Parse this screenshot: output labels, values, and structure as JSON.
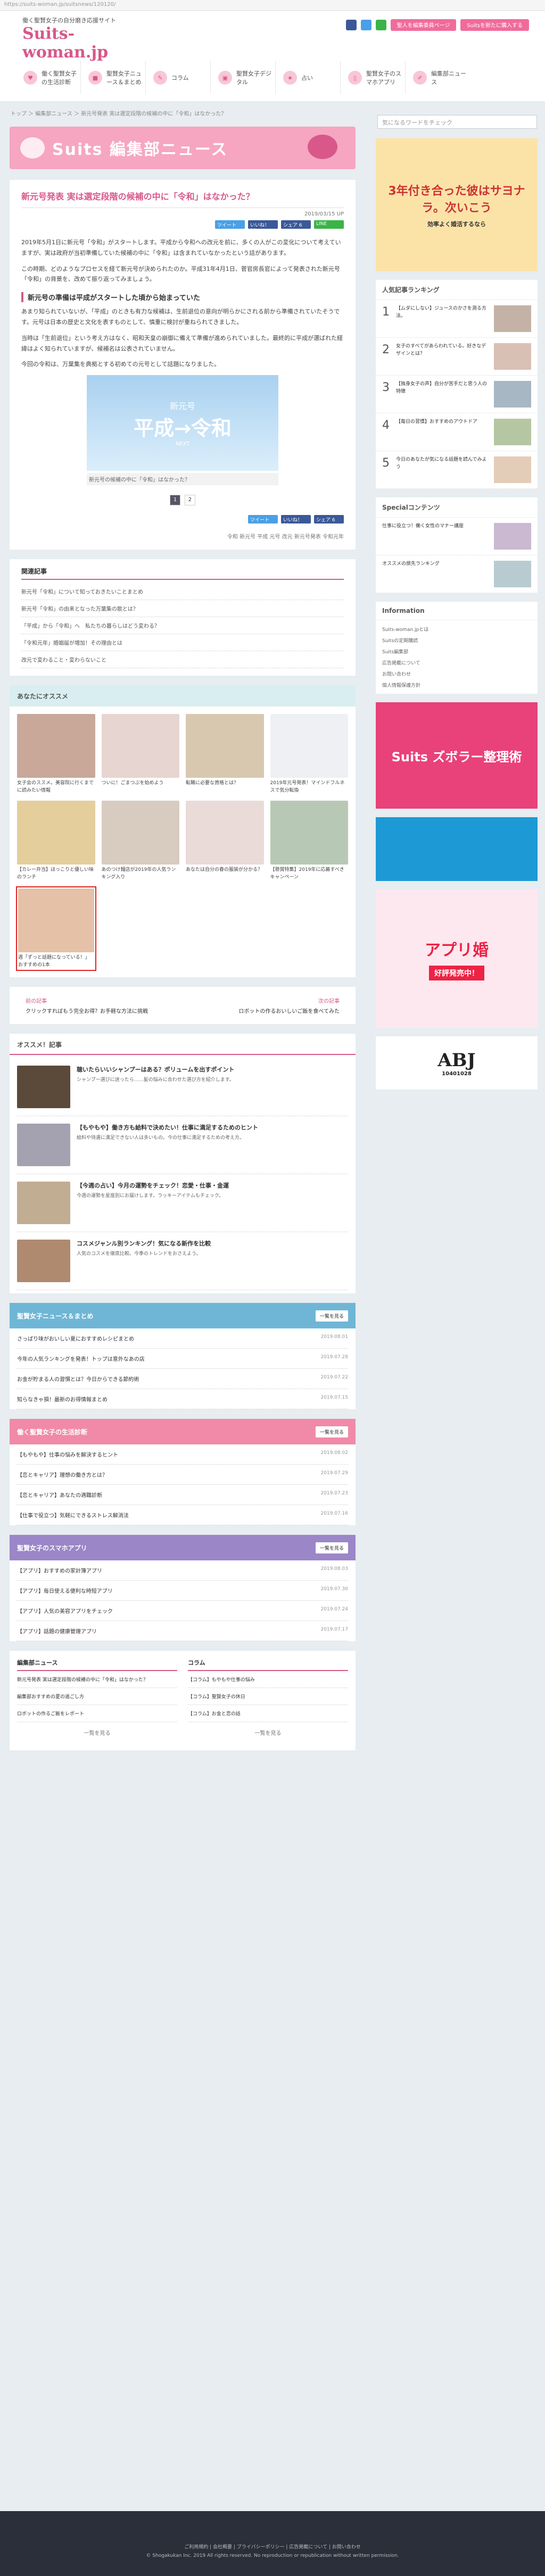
{
  "url_bar": "https://suits-woman.jp/suitsnews/120120/",
  "header": {
    "tagline": "働く聖賢女子の自分磨き応援サイト",
    "brand": "Suits-woman.jp",
    "btn_editor": "聖人を編集委員ページ",
    "btn_register": "Suitsを新たに購入する",
    "nav": [
      {
        "label": "働く聖賢女子の生活診断",
        "icon": "heart-icon"
      },
      {
        "label": "聖賢女子ニュース＆まとめ",
        "icon": "news-icon"
      },
      {
        "label": "コラム",
        "icon": "column-icon"
      },
      {
        "label": "聖賢女子デジタル",
        "icon": "digital-icon"
      },
      {
        "label": "占い",
        "icon": "fortune-icon"
      },
      {
        "label": "聖賢女子のスマホアプリ",
        "icon": "phone-icon"
      },
      {
        "label": "編集部ニュース",
        "icon": "pencil-icon"
      }
    ]
  },
  "breadcrumb": "トップ ＞ 編集部ニュース ＞ 新元号発表 実は選定段階の候補の中に「令和」はなかった？",
  "search": {
    "placeholder": "気になるワードをチェック"
  },
  "banner": {
    "title": "Suits 編集部ニュース"
  },
  "article": {
    "title": "新元号発表 実は選定段階の候補の中に「令和」はなかった？",
    "date": "2019/03/15 UP",
    "share": [
      "ツイート",
      "いいね！ 22",
      "シェア 6",
      "LINE"
    ],
    "p1": "2019年5月1日に新元号「令和」がスタートします。平成から令和への改元を前に、多くの人がこの変化について考えていますが、実は政府が当初準備していた候補の中に「令和」は含まれていなかったという話があります。",
    "p2": "この時期、どのようなプロセスを経て新元号が決められたのか。平成31年4月1日、菅官房長官によって発表された新元号「令和」の背景を、改めて振り返ってみましょう。",
    "sub1": "新元号の準備は平成がスタートした頃から始まっていた",
    "p3": "あまり知られていないが、「平成」のときも有力な候補は、生前退位の意向が明らかにされる前から準備されていたそうです。元号は日本の歴史と文化を表すものとして、慎重に検討が重ねられてきました。",
    "p4": "当時は「生前退位」という考え方はなく、昭和天皇の崩御に備えて準備が進められていました。最終的に平成が選ばれた経緯はよく知られていますが、候補名は公表されていません。",
    "p5": "今回の令和は、万葉集を典拠とする初めての元号として話題になりました。",
    "image": {
      "small": "新元号",
      "big": "平成→令和",
      "tiny": "NEXT",
      "caption": "新元号の候補の中に「令和」はなかった？"
    },
    "pages": [
      "1",
      "2"
    ],
    "tags": "令和  新元号  平成  元号  改元  新元号発表  令和元年"
  },
  "related": {
    "title": "関連記事",
    "items": [
      "新元号「令和」について知っておきたいことまとめ",
      "新元号「令和」の由来となった万葉集の歌とは？",
      "「平成」から「令和」へ　私たちの暮らしはどう変わる？",
      "「令和元年」婚姻届が増加！その理由とは",
      "改元で変わること・変わらないこと"
    ]
  },
  "recommend": {
    "title": "あなたにオススメ",
    "items": [
      "女子会のススメ。美容院に行くまでに読みたい情報",
      "ついに！ごまつぶを始めよう",
      "転職に必要な資格とは？",
      "2019年元号発表！マインドフルネスで気分転換",
      "【カレー弁当】ほっこりと優しい味のランチ",
      "あのつけ麺店が2019年の人気ランキング入り",
      "あなたは自分の春の服装が分かる？",
      "【懸賞特集】2019年に応募すべきキャンペーン",
      "週「ずっと話題になっている！」おすすめの1本"
    ]
  },
  "prevnext": {
    "prev_label": "前の記事",
    "next_label": "次の記事",
    "prev": "クリックすればもう完全お得？お手軽な方法に挑戦",
    "next": "ロボットの作るおいしいご飯を食べてみた"
  },
  "osusume": {
    "title": "オススメ！記事",
    "items": [
      {
        "t": "聴いたらいいシャンプーはある？ポリュームを出すポイント",
        "d": "シャンプー選びに迷ったら……髪の悩みに合わせた選び方を紹介します。"
      },
      {
        "t": "【もやもや】働き方も給料で決めたい！仕事に満足するためのヒント",
        "d": "給料や待遇に満足できない人は多いもの。今の仕事に満足するための考え方。"
      },
      {
        "t": "【今週の占い】今月の運勢をチェック！恋愛・仕事・金運",
        "d": "今週の運勢を星座別にお届けします。ラッキーアイテムもチェック。"
      },
      {
        "t": "コスメジャンル別ランキング！気になる新作を比較",
        "d": "人気のコスメを徹底比較。今季のトレンドをおさえよう。"
      }
    ]
  },
  "news": {
    "title": "聖賢女子ニュース＆まとめ",
    "btn": "一覧を見る",
    "items": [
      "さっぱり味がおいしい夏におすすめレシピまとめ",
      "今年の人気ランキングを発表！トップは意外なあの店",
      "お金が貯まる人の習慣とは？今日からできる節約術",
      "知らなきゃ損！最新のお得情報まとめ"
    ],
    "dates": [
      "2019.08.01",
      "2019.07.28",
      "2019.07.22",
      "2019.07.15"
    ]
  },
  "diag": {
    "title": "働く聖賢女子の生活診断",
    "btn": "一覧を見る",
    "items": [
      "【もやもや】仕事の悩みを解決するヒント",
      "【恋とキャリア】理想の働き方とは？",
      "【恋とキャリア】あなたの適職診断",
      "【仕事で役立つ】気軽にできるストレス解消法"
    ],
    "dates": [
      "2019.08.02",
      "2019.07.29",
      "2019.07.23",
      "2019.07.16"
    ]
  },
  "apps": {
    "title": "聖賢女子のスマホアプリ",
    "btn": "一覧を見る",
    "items": [
      "【アプリ】おすすめの家計簿アプリ",
      "【アプリ】毎日使える便利な時短アプリ",
      "【アプリ】人気の美容アプリをチェック",
      "【アプリ】話題の健康管理アプリ"
    ],
    "dates": [
      "2019.08.03",
      "2019.07.30",
      "2019.07.24",
      "2019.07.17"
    ]
  },
  "bottom": {
    "left_title": "編集部ニュース",
    "right_title": "コラム",
    "left": [
      "新元号発表 実は選定段階の候補の中に「令和」はなかった？",
      "編集部おすすめの夏の過ごし方",
      "ロボットの作るご飯をレポート"
    ],
    "right": [
      "【コラム】もやもや仕事の悩み",
      "【コラム】聖賢女子の休日",
      "【コラム】お金と恋の話"
    ],
    "more": "一覧を見る"
  },
  "side": {
    "ad1": "3年付き合った彼はサヨナラ。次いこう",
    "ad1sub": "効率よく婚活するなら",
    "ranking_title": "人気記事ランキング",
    "ranking": [
      "【ムダにしない】ジュースのかさを測る方法。",
      "女子のすべてがあらわれている。好きなデザインとは？",
      "【独身女子の声】自分が苦手だと思う人の特徴",
      "【毎日の習慣】おすすめのアウトドア",
      "今日のあなたが気になる話題を読んでみよう"
    ],
    "special_title": "Specialコンテンツ",
    "special": [
      "仕事に役立つ！働く女性のマナー講座",
      "オススメの旅先ランキング"
    ],
    "info_title": "Information",
    "info": [
      "Suits-woman.jpとは",
      "Suitsの定期購読",
      "Suits編集部",
      "広告掲載について",
      "お問い合わせ",
      "個人情報保護方針"
    ],
    "ad2": "Suits ズボラー整理術",
    "ad3": "アプリ婚",
    "ad4": "好評発売中！",
    "abj": "ABJ",
    "abj_no": "10401028"
  },
  "footer": {
    "links": "ご利用規約 | 会社概要 | プライバシーポリシー | 広告掲載について | お問い合わせ",
    "copy": "© Shogakukan Inc. 2019  All rights reserved. No reproduction or republication without written permission."
  }
}
